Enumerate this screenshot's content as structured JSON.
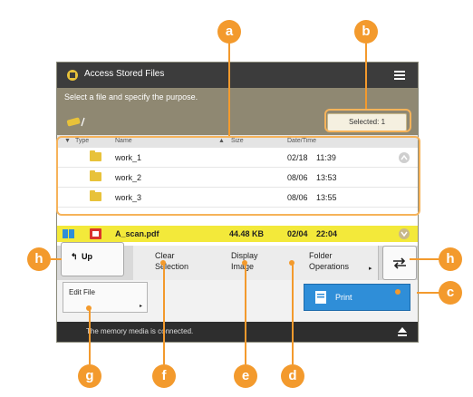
{
  "window": {
    "title": "Access Stored Files",
    "instruction": "Select a file and specify the purpose."
  },
  "selected_label": "Selected: 1",
  "columns": {
    "type": "Type",
    "name": "Name",
    "size": "Size",
    "datetime": "Date/Time"
  },
  "files": [
    {
      "name": "work_1",
      "date": "02/18",
      "time": "11:39"
    },
    {
      "name": "work_2",
      "date": "08/06",
      "time": "13:53"
    },
    {
      "name": "work_3",
      "date": "08/06",
      "time": "13:55"
    }
  ],
  "selected_file": {
    "name": "A_scan.pdf",
    "size": "44.48 KB",
    "date": "02/04",
    "time": "22:04"
  },
  "buttons": {
    "up": "Up",
    "clear_selection_1": "Clear",
    "clear_selection_2": "Selection",
    "display_image_1": "Display",
    "display_image_2": "Image",
    "folder_operations_1": "Folder",
    "folder_operations_2": "Operations",
    "edit_file": "Edit File",
    "print": "Print"
  },
  "status_text": "The memory media is connected.",
  "callouts": {
    "a": "a",
    "b": "b",
    "c": "c",
    "d": "d",
    "e": "e",
    "f": "f",
    "g": "g",
    "h_left": "h",
    "h_right": "h"
  },
  "colors": {
    "accent": "#f39a2d",
    "selected_row": "#f3e93a",
    "print_button": "#2f8ed8"
  }
}
